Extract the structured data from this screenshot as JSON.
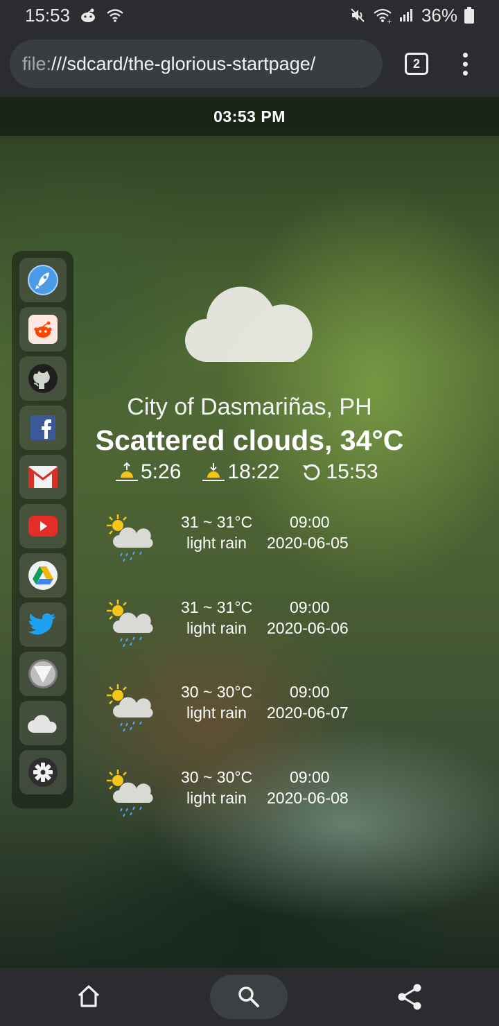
{
  "status_bar": {
    "time": "15:53",
    "battery": "36%",
    "icons": [
      "reddit-notification-icon",
      "wifi-icon",
      "mute-icon",
      "wifi-signal-icon",
      "cell-signal-icon",
      "battery-icon"
    ]
  },
  "browser": {
    "url_scheme": "file:",
    "url_rest": "///sdcard/the-glorious-startpage/",
    "tab_count": "2"
  },
  "page": {
    "clock": "03:53 PM"
  },
  "dock": {
    "items": [
      {
        "name": "firefox-app",
        "icon": "rocket-icon",
        "color": "#3d8de0"
      },
      {
        "name": "reddit-app",
        "icon": "reddit-icon",
        "color": "#ff4500"
      },
      {
        "name": "github-app",
        "icon": "github-icon",
        "color": "#222222"
      },
      {
        "name": "facebook-app",
        "icon": "facebook-icon",
        "color": "#3b5998"
      },
      {
        "name": "gmail-app",
        "icon": "gmail-icon",
        "color": "#d93025"
      },
      {
        "name": "youtube-app",
        "icon": "youtube-icon",
        "color": "#e52d27"
      },
      {
        "name": "google-drive-app",
        "icon": "drive-icon",
        "color": "#1fa463"
      },
      {
        "name": "twitter-app",
        "icon": "twitter-icon",
        "color": "#1da1f2"
      },
      {
        "name": "vim-app",
        "icon": "v-icon",
        "color": "#9e9e9e"
      },
      {
        "name": "weather-app",
        "icon": "cloud-icon",
        "color": "#e0e0e0"
      },
      {
        "name": "settings-app",
        "icon": "gear-icon",
        "color": "#333333"
      }
    ]
  },
  "weather": {
    "city": "City of Dasmariñas, PH",
    "condition": "Scattered clouds, 34°C",
    "sunrise": "5:26",
    "sunset": "18:22",
    "updated": "15:53",
    "forecast": [
      {
        "temp": "31 ~ 31°C",
        "time": "09:00",
        "desc": "light rain",
        "date": "2020-06-05"
      },
      {
        "temp": "31 ~ 31°C",
        "time": "09:00",
        "desc": "light rain",
        "date": "2020-06-06"
      },
      {
        "temp": "30 ~ 30°C",
        "time": "09:00",
        "desc": "light rain",
        "date": "2020-06-07"
      },
      {
        "temp": "30 ~ 30°C",
        "time": "09:00",
        "desc": "light rain",
        "date": "2020-06-08"
      }
    ]
  },
  "bottom_nav": {
    "items": [
      "home-icon",
      "search-icon",
      "share-icon"
    ]
  }
}
